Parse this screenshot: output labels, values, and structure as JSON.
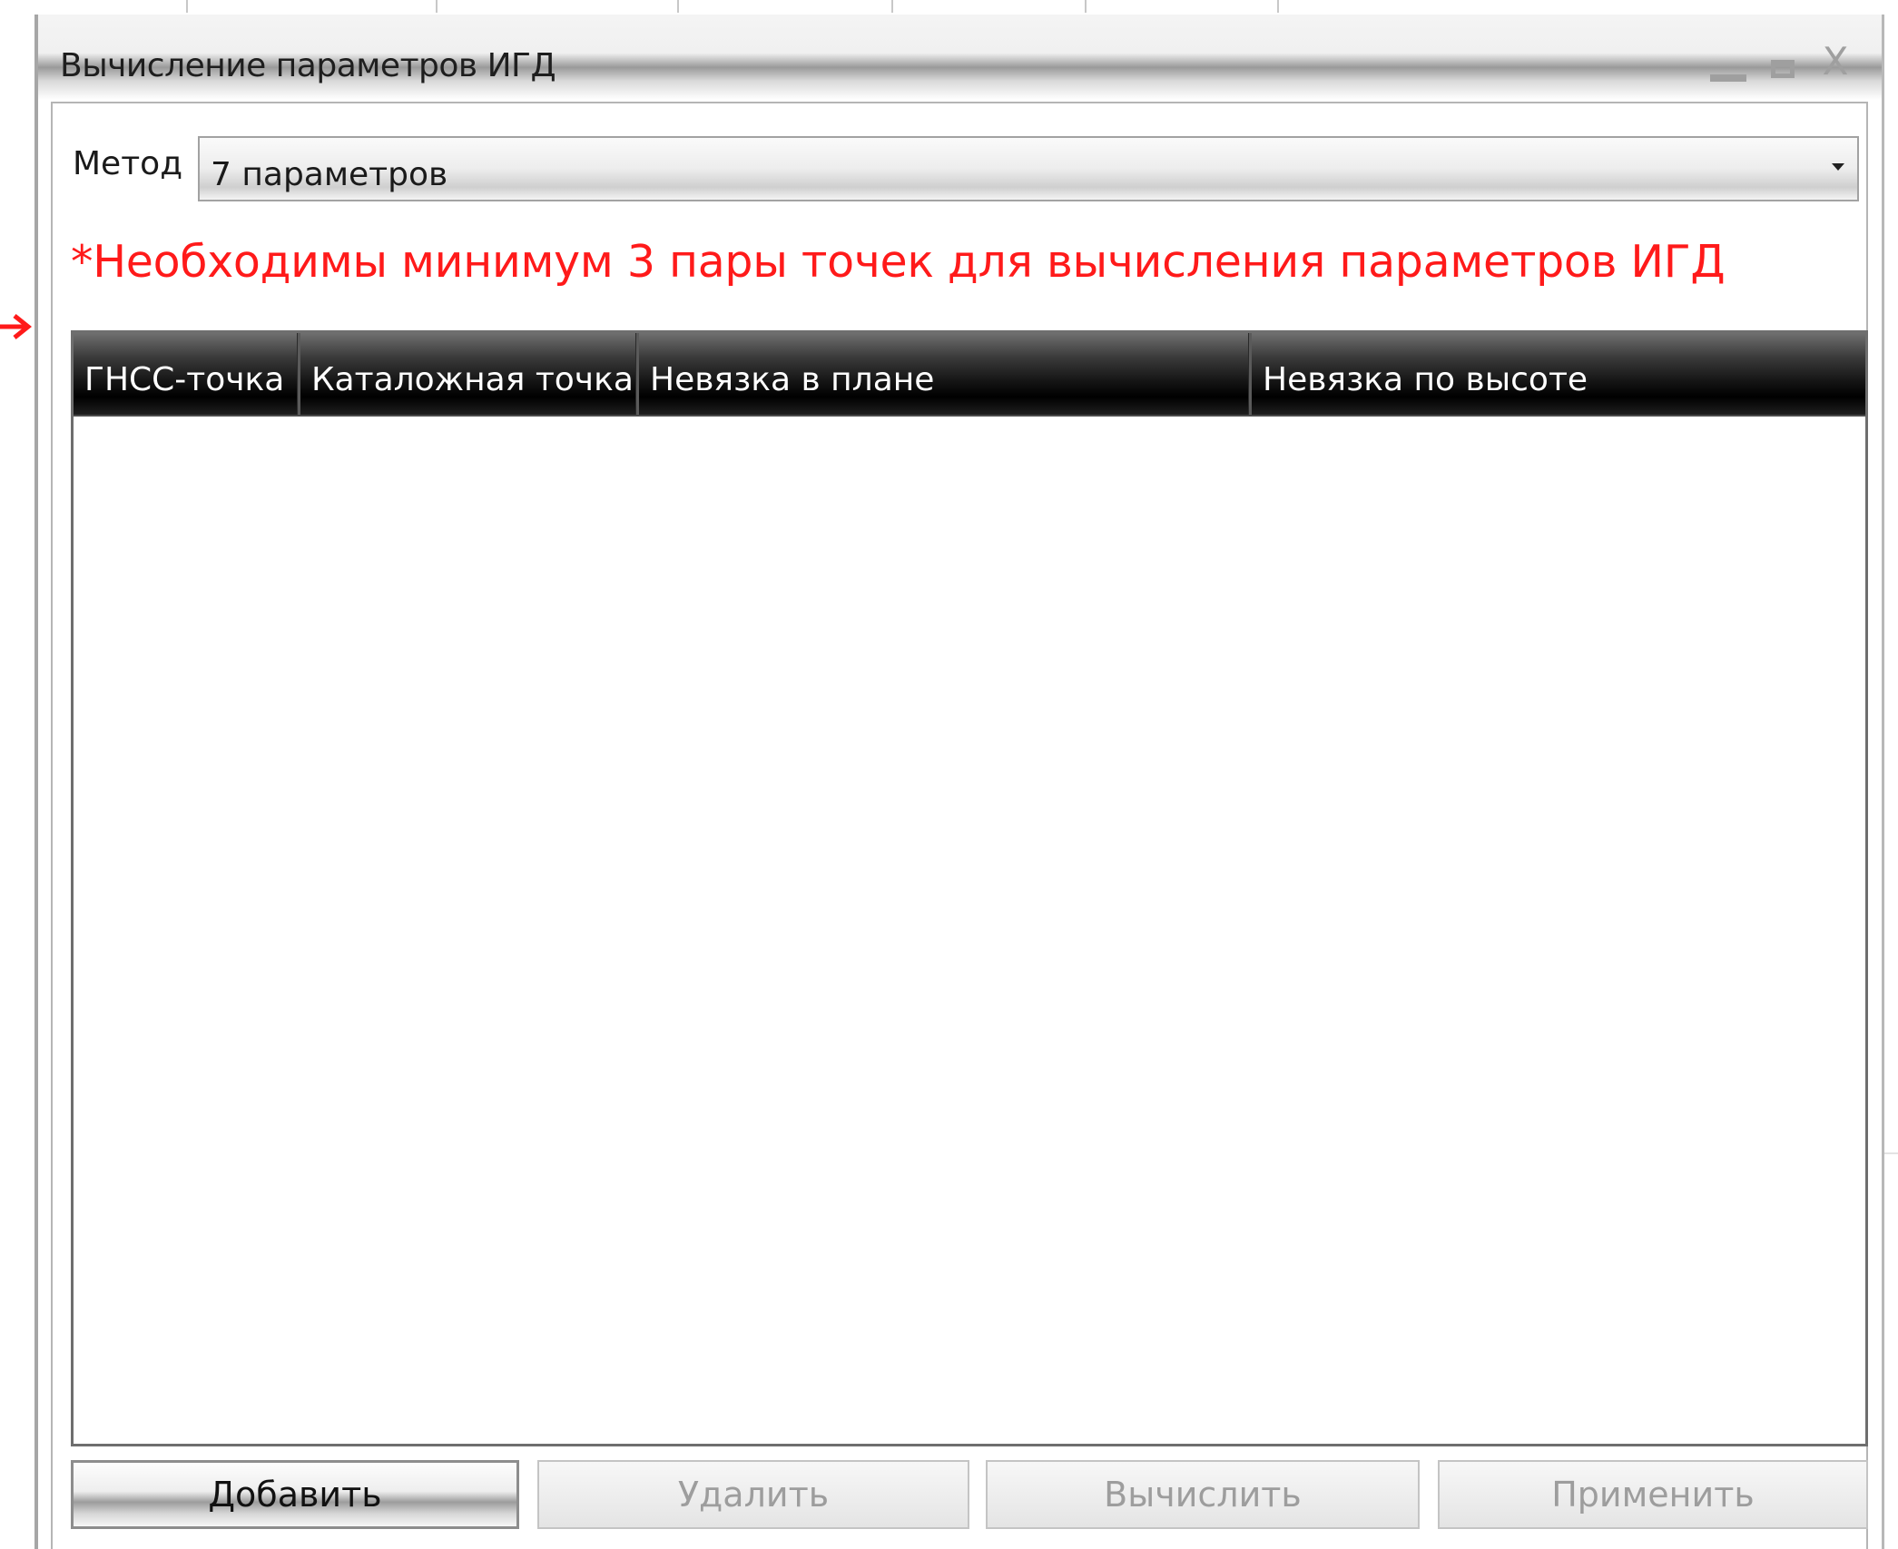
{
  "window": {
    "title": "Вычисление параметров ИГД"
  },
  "method": {
    "label": "Метод",
    "selected": "7 параметров"
  },
  "warning": "*Необходимы минимум 3 пары точек для вычисления параметров ИГД",
  "table": {
    "columns": [
      "ГНСС-точка",
      "Каталожная точка",
      "Невязка в плане",
      "Невязка по высоте"
    ],
    "rows": []
  },
  "buttons": {
    "add": "Добавить",
    "delete": "Удалить",
    "compute": "Вычислить",
    "apply": "Применить"
  },
  "colors": {
    "warning": "#ff1a1a",
    "annotation_arrow": "#ff1a1a",
    "header_background": "#000000",
    "header_text": "#ffffff",
    "disabled_text": "#9d9d9d"
  },
  "icons": [
    "minimize-icon",
    "maximize-icon",
    "close-icon",
    "chevron-down-icon",
    "arrow-right-icon"
  ]
}
